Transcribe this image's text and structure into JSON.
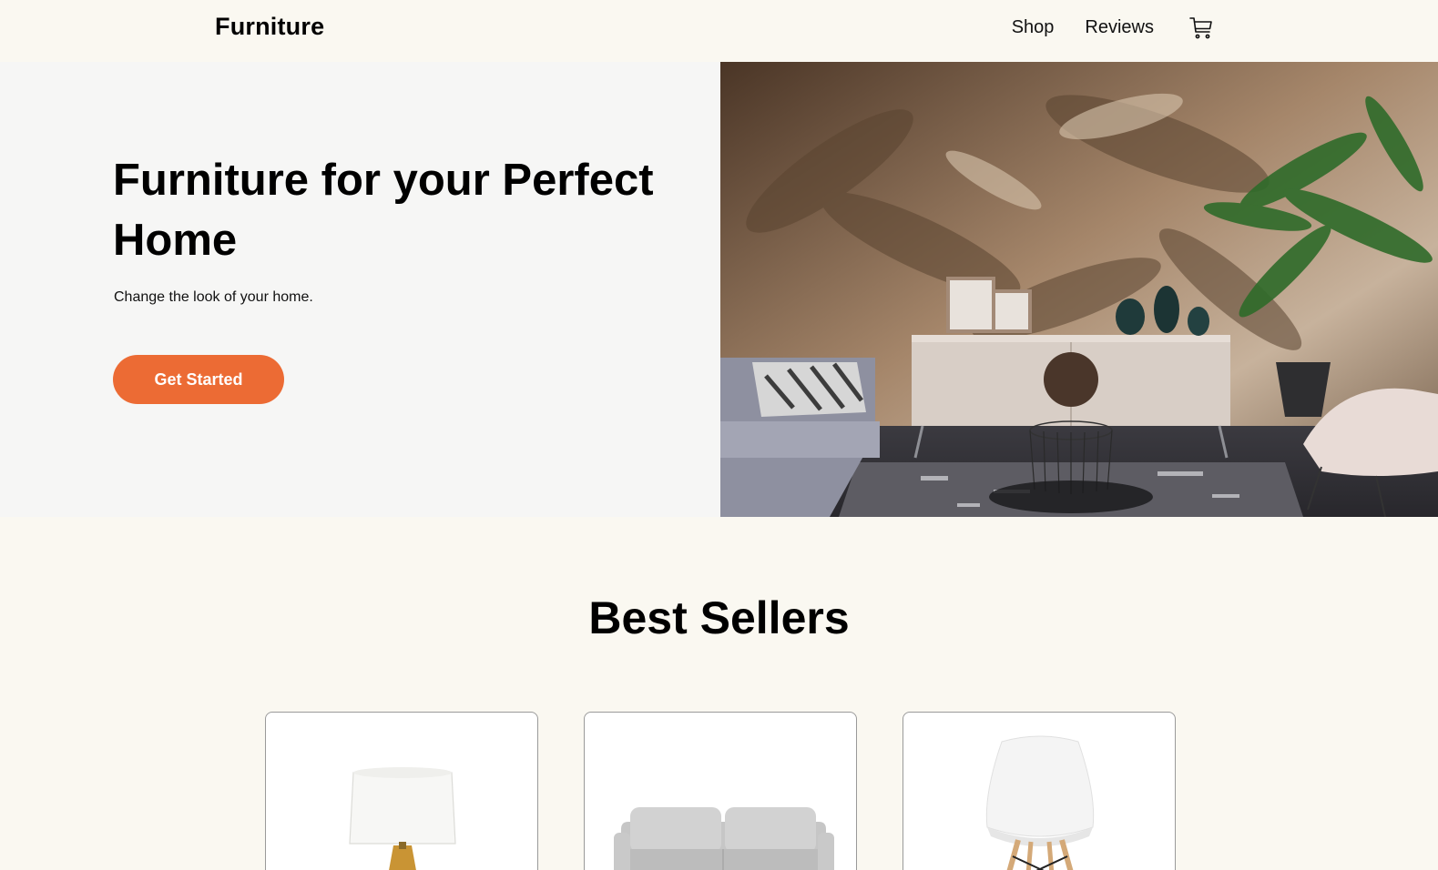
{
  "header": {
    "logo": "Furniture",
    "nav": [
      {
        "label": "Shop"
      },
      {
        "label": "Reviews"
      }
    ],
    "cart_icon": "shopping-cart-icon"
  },
  "hero": {
    "title": "Furniture for your Perfect Home",
    "subtitle": "Change the look of your home.",
    "cta_label": "Get Started",
    "cta_color": "#ec6b34",
    "image_icon": "living-room-photo"
  },
  "best_sellers": {
    "title": "Best Sellers",
    "products": [
      {
        "image": "table-lamp-image"
      },
      {
        "image": "grey-sofa-image"
      },
      {
        "image": "white-chair-image"
      }
    ]
  }
}
